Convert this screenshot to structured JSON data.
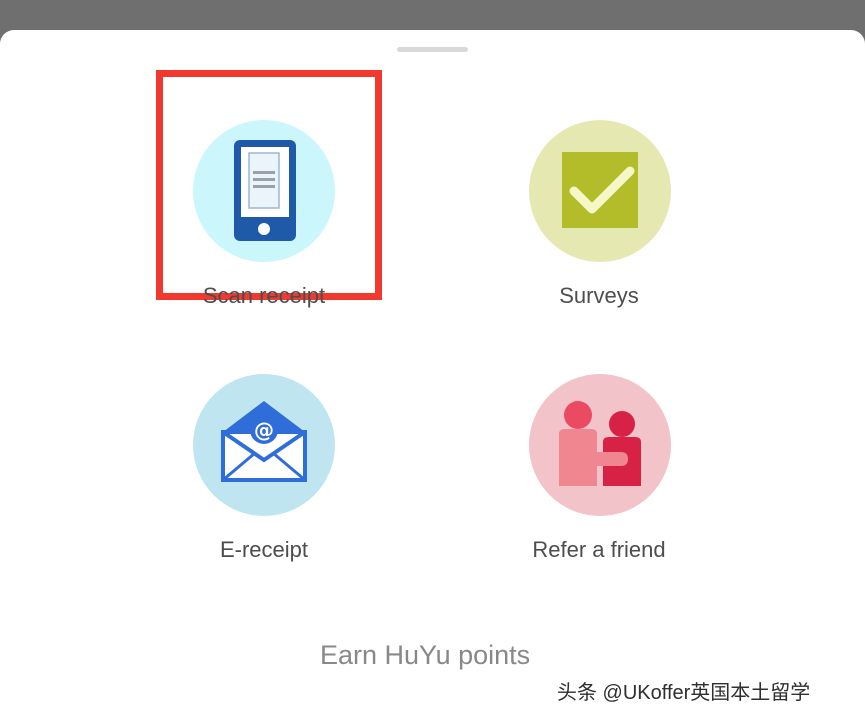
{
  "options": [
    {
      "label": "Scan receipt",
      "icon": "phone-receipt-icon",
      "circle_color": "#cbf6fb",
      "selected": true
    },
    {
      "label": "Surveys",
      "icon": "checkbox-icon",
      "circle_color": "#e6e8b2",
      "selected": false
    },
    {
      "label": "E-receipt",
      "icon": "email-envelope-icon",
      "circle_color": "#bfe6f0",
      "selected": false
    },
    {
      "label": "Refer a friend",
      "icon": "people-icon",
      "circle_color": "#f2c3c8",
      "selected": false
    }
  ],
  "footer": {
    "title": "Earn HuYu points"
  },
  "watermark": {
    "text": "头条 @UKoffer英国本土留学"
  },
  "colors": {
    "highlight": "#f2392f",
    "label": "#4d4d4d"
  }
}
